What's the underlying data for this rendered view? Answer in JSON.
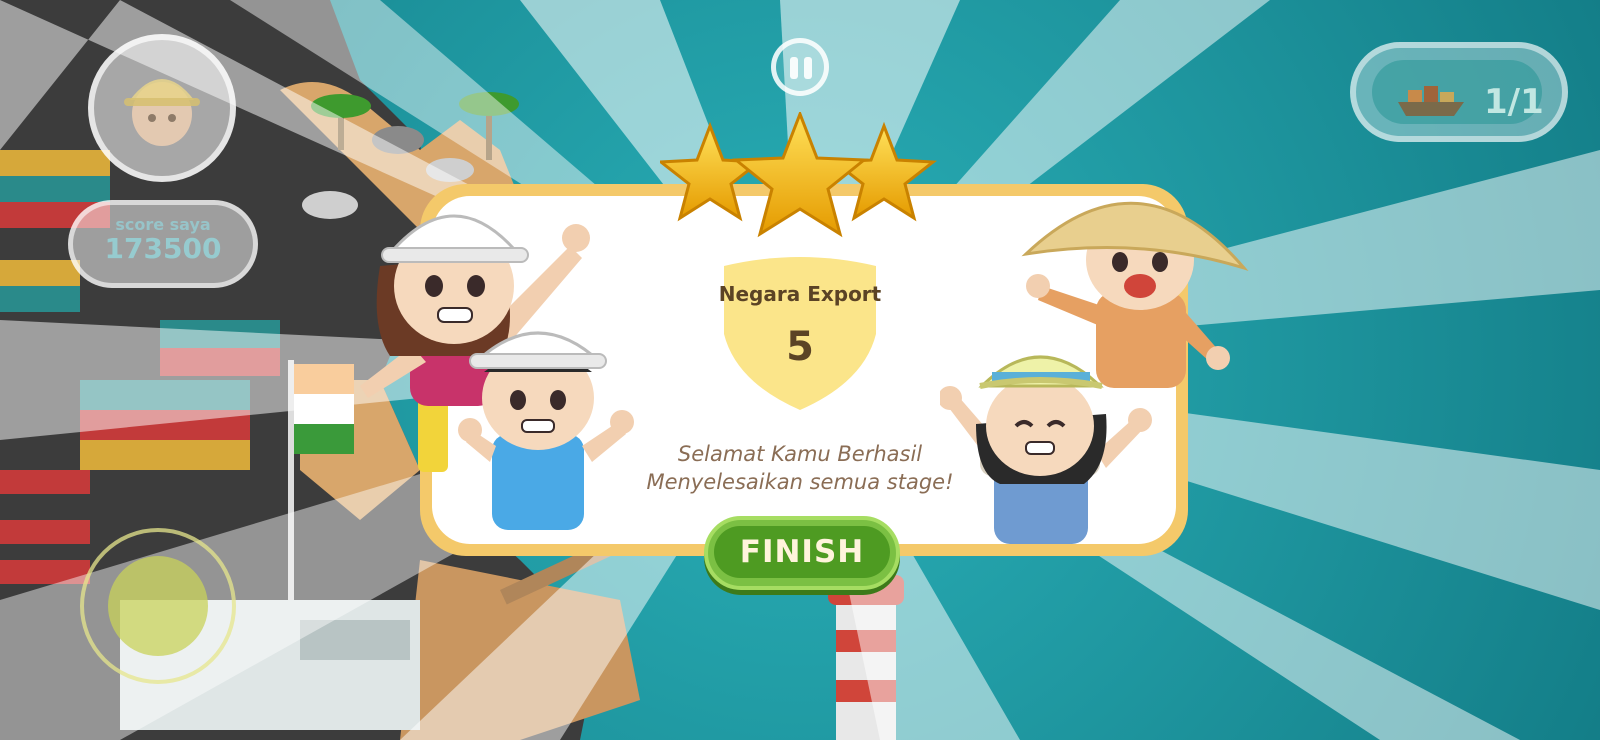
{
  "hud": {
    "score_label": "score saya",
    "score_value": "173500",
    "progress_text": "1/1"
  },
  "result": {
    "badge_title": "Negara Export",
    "badge_value": "5",
    "message_line1": "Selamat Kamu Berhasil",
    "message_line2": "Menyelesaikan semua stage!",
    "stars_earned": 3,
    "stars_total": 3
  },
  "buttons": {
    "finish_label": "FINISH"
  },
  "colors": {
    "panel_border": "#f4c96a",
    "badge_fill": "#fbe58a",
    "finish_green": "#4e9b22",
    "star_gold": "#f5b800",
    "text_brown": "#5b4325"
  },
  "icons": [
    "pause-icon",
    "cargo-ship-icon",
    "avatar-icon",
    "star-icon"
  ]
}
